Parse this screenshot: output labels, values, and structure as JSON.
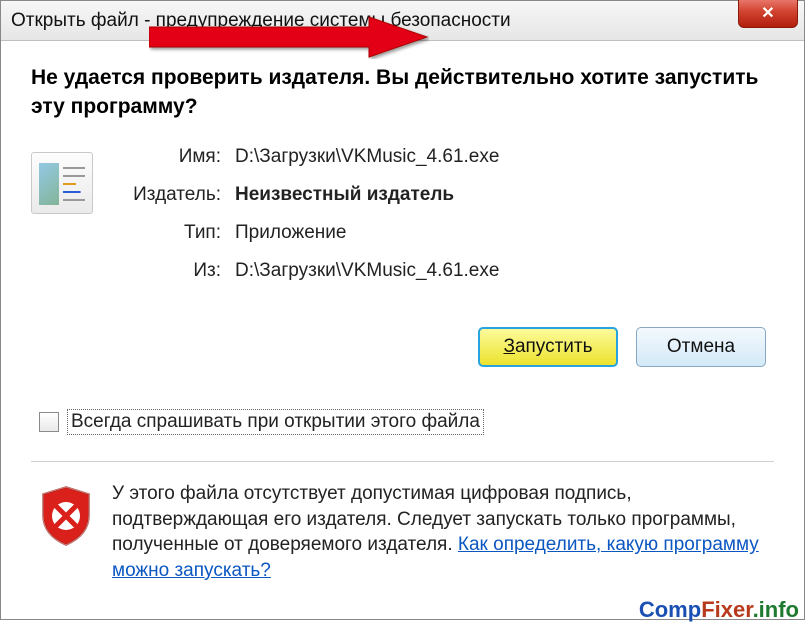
{
  "window": {
    "title": "Открыть файл - предупреждение системы безопасности"
  },
  "heading": "Не удается проверить издателя.  Вы действительно хотите запустить эту программу?",
  "info": {
    "name_label": "Имя:",
    "name_value": "D:\\Загрузки\\VKMusic_4.61.exe",
    "publisher_label": "Издатель:",
    "publisher_value": "Неизвестный издатель",
    "type_label": "Тип:",
    "type_value": "Приложение",
    "from_label": "Из:",
    "from_value": "D:\\Загрузки\\VKMusic_4.61.exe"
  },
  "buttons": {
    "run_prefix": "З",
    "run_rest": "апустить",
    "cancel": "Отмена"
  },
  "checkbox": {
    "label": "Всегда спрашивать при открытии этого файла"
  },
  "warning": {
    "text": "У этого файла отсутствует допустимая цифровая подпись, подтверждающая его издателя.  Следует запускать только программы, полученные от доверяемого издателя.  ",
    "link": "Как определить, какую программу можно запускать?"
  },
  "watermark": {
    "p1": "Comp",
    "p2": "Fixer",
    "p3": ".info"
  }
}
